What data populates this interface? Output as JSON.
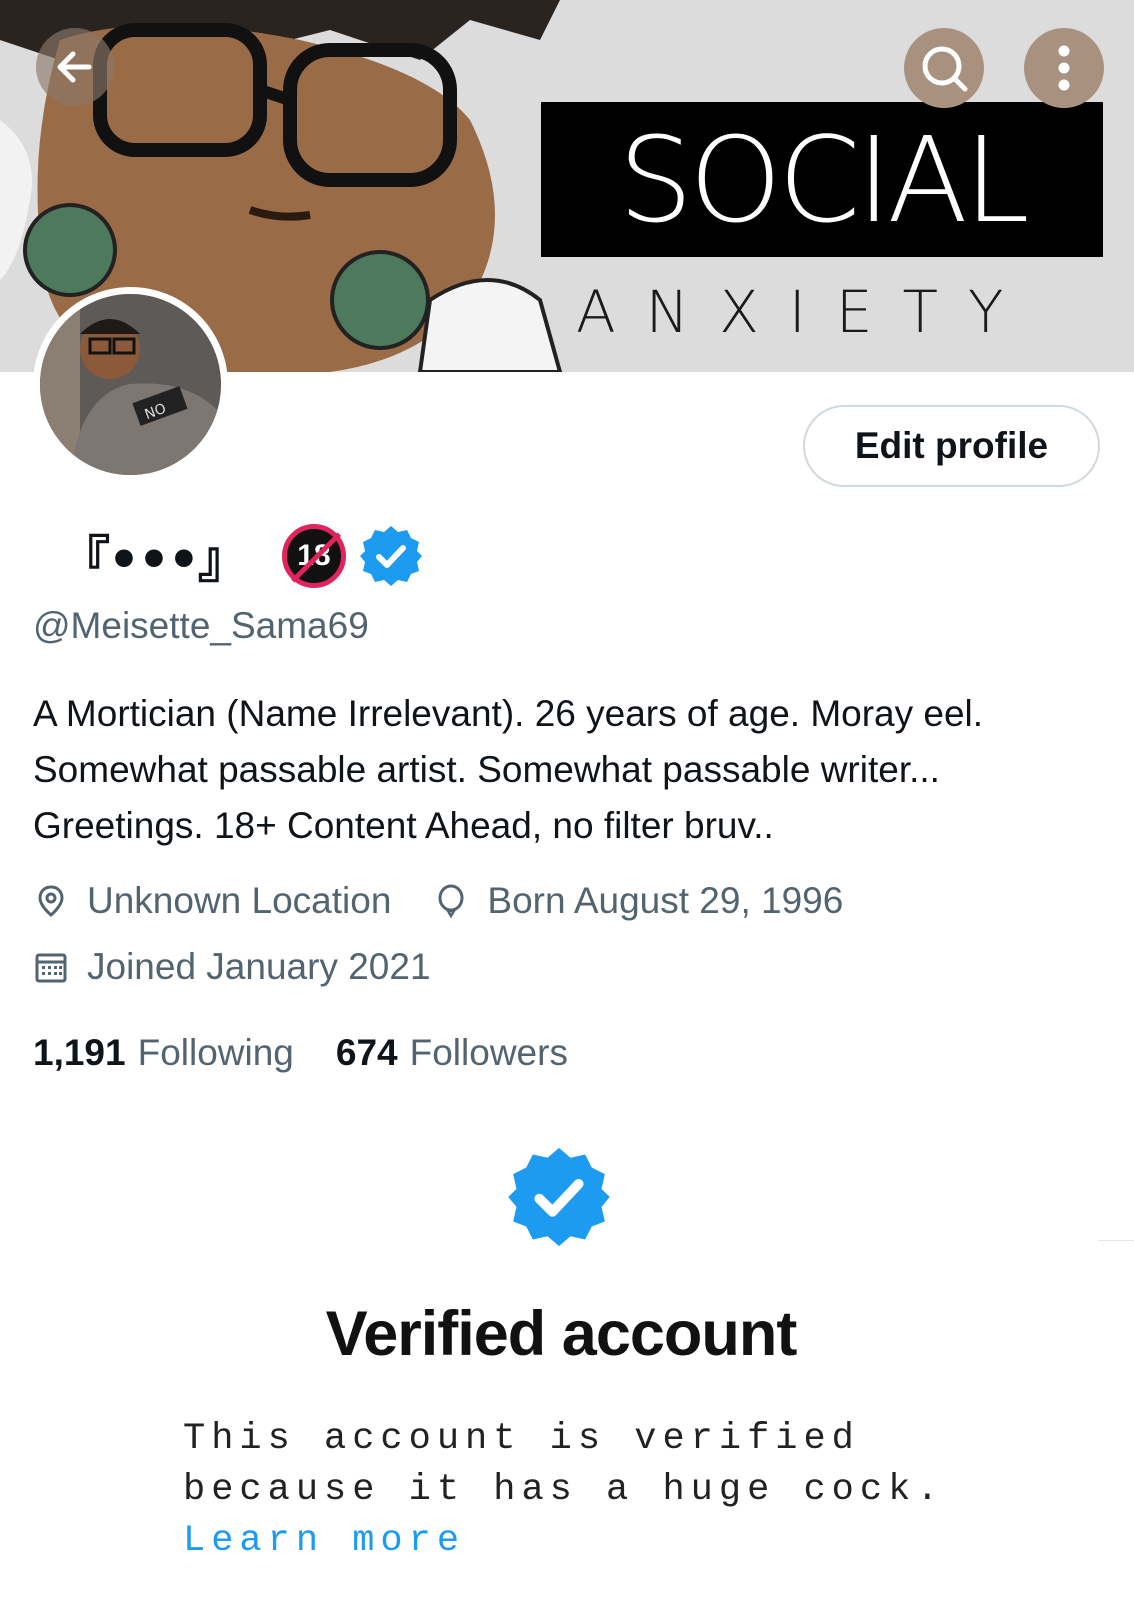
{
  "banner": {
    "title_big": "SOCIAL",
    "title_small": "ANXIETY"
  },
  "header": {
    "back_icon": "arrow-left-icon",
    "search_icon": "search-icon",
    "more_icon": "more-vertical-icon"
  },
  "profile": {
    "edit_label": "Edit profile",
    "display_name": "『•••』",
    "age_badge": "18",
    "handle": "@Meisette_Sama69",
    "bio": "A Mortician (Name Irrelevant). 26 years of age. Moray eel. Somewhat passable artist. Somewhat passable writer... Greetings. 18+ Content Ahead, no filter bruv..",
    "location": "Unknown Location",
    "birthday": "Born August 29, 1996",
    "joined": "Joined January 2021",
    "following_count": "1,191",
    "following_label": "Following",
    "followers_count": "674",
    "followers_label": "Followers"
  },
  "verified_card": {
    "title": "Verified account",
    "body": "This account is verified because it has a huge cock. ",
    "link": "Learn more"
  },
  "colors": {
    "accent": "#1d9bf0",
    "muted_text": "#536471",
    "age_badge_ring": "#e0245e"
  }
}
